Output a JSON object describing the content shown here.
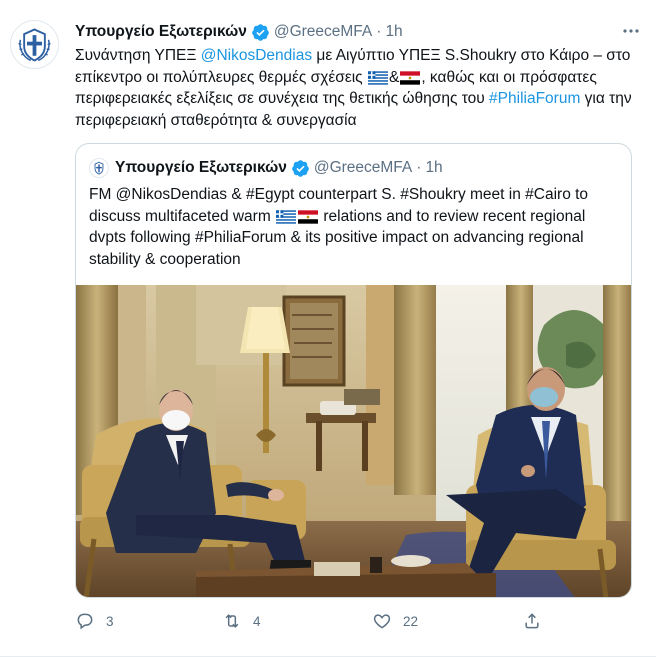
{
  "tweet": {
    "author_name": "Υπουργείο Εξωτερικών",
    "author_handle": "@GreeceMFA",
    "separator": "·",
    "time": "1h",
    "text": {
      "p1": "Συνάντηση ΥΠΕΞ ",
      "mention": "@NikosDendias",
      "p2": " με Αιγύπτιο ΥΠΕΞ S.Shoukry στο Κάιρο – στο επίκεντρο οι πολύπλευρες θερμές σχέσεις ",
      "amp": "&",
      "p3": ", καθώς και οι πρόσφατες περιφερειακές εξελίξεις σε συνέχεια της θετικής ώθησης του ",
      "hashtag": "#PhiliaForum",
      "p4": " για την περιφερειακή σταθερότητα & συνεργασία"
    },
    "icons": {
      "avatar": "greek-coat-of-arms",
      "verified": "verified-badge-icon",
      "more": "more-options-icon",
      "flag_1": "greece-flag",
      "flag_2": "egypt-flag"
    },
    "colors": {
      "link": "#1b95e0",
      "muted": "#5b7083",
      "verified": "#1da1f2"
    }
  },
  "quoted_tweet": {
    "author_name": "Υπουργείο Εξωτερικών",
    "author_handle": "@GreeceMFA",
    "separator": "·",
    "time": "1h",
    "text": {
      "p1": "FM @NikosDendias & #Egypt counterpart S. #Shoukry meet in #Cairo to discuss multifaceted warm ",
      "p2": " relations and to review recent regional dvpts following #PhiliaForum & its positive impact on advancing regional stability & cooperation"
    },
    "image_subject": "meeting-photo"
  },
  "actions": {
    "reply_count": "3",
    "retweet_count": "4",
    "like_count": "22",
    "icons": [
      "reply-icon",
      "retweet-icon",
      "like-icon",
      "share-icon"
    ]
  }
}
